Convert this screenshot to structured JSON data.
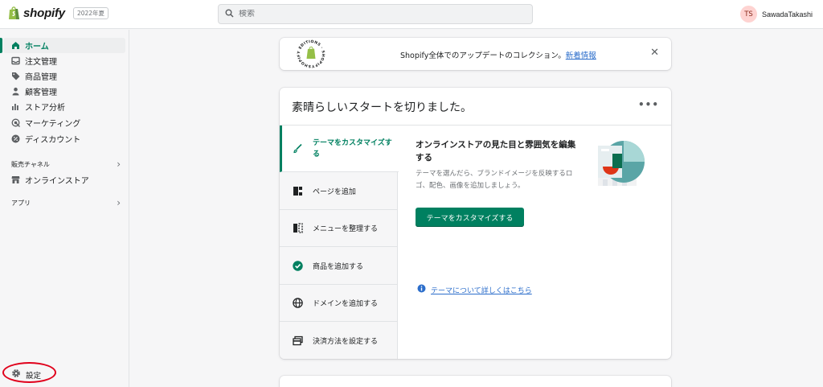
{
  "topbar": {
    "logo_text": "shopify",
    "edition": "2022年夏",
    "search_placeholder": "検索",
    "user_initials": "TS",
    "user_name": "SawadaTakashi"
  },
  "sidebar": {
    "items": [
      {
        "label": "ホーム",
        "icon": "home-icon",
        "active": true
      },
      {
        "label": "注文管理",
        "icon": "inbox-icon"
      },
      {
        "label": "商品管理",
        "icon": "tag-icon"
      },
      {
        "label": "顧客管理",
        "icon": "person-icon"
      },
      {
        "label": "ストア分析",
        "icon": "bar-chart-icon"
      },
      {
        "label": "マーケティング",
        "icon": "target-icon"
      },
      {
        "label": "ディスカウント",
        "icon": "discount-icon"
      }
    ],
    "sales_channels_label": "販売チャネル",
    "online_store_label": "オンラインストア",
    "apps_label": "アプリ",
    "settings_label": "設定"
  },
  "banner": {
    "text": "Shopify全体でのアップデートのコレクション。",
    "link": "新着情報",
    "seal_text": "SHOPIFY EDITIONS"
  },
  "setup": {
    "title": "素晴らしいスタートを切りました。",
    "more_label": "•••",
    "tasks": [
      {
        "label": "テーマをカスタマイズする",
        "icon": "brush-icon",
        "active": true
      },
      {
        "label": "ページを追加",
        "icon": "page-icon"
      },
      {
        "label": "メニューを整理する",
        "icon": "menu-icon"
      },
      {
        "label": "商品を追加する",
        "icon": "check-circle-icon",
        "done": true
      },
      {
        "label": "ドメインを追加する",
        "icon": "globe-icon"
      },
      {
        "label": "決済方法を設定する",
        "icon": "card-icon"
      }
    ],
    "detail_title": "オンラインストアの見た目と雰囲気を編集する",
    "detail_desc": "テーマを選んだら、ブランドイメージを反映するロゴ、配色、画像を追加しましょう。",
    "cta_label": "テーマをカスタマイズする",
    "learn_label": "テーマについて詳しくはこちら"
  },
  "colors": {
    "accent": "#008060",
    "link": "#2c6ecb",
    "annotation": "#e0001b"
  }
}
